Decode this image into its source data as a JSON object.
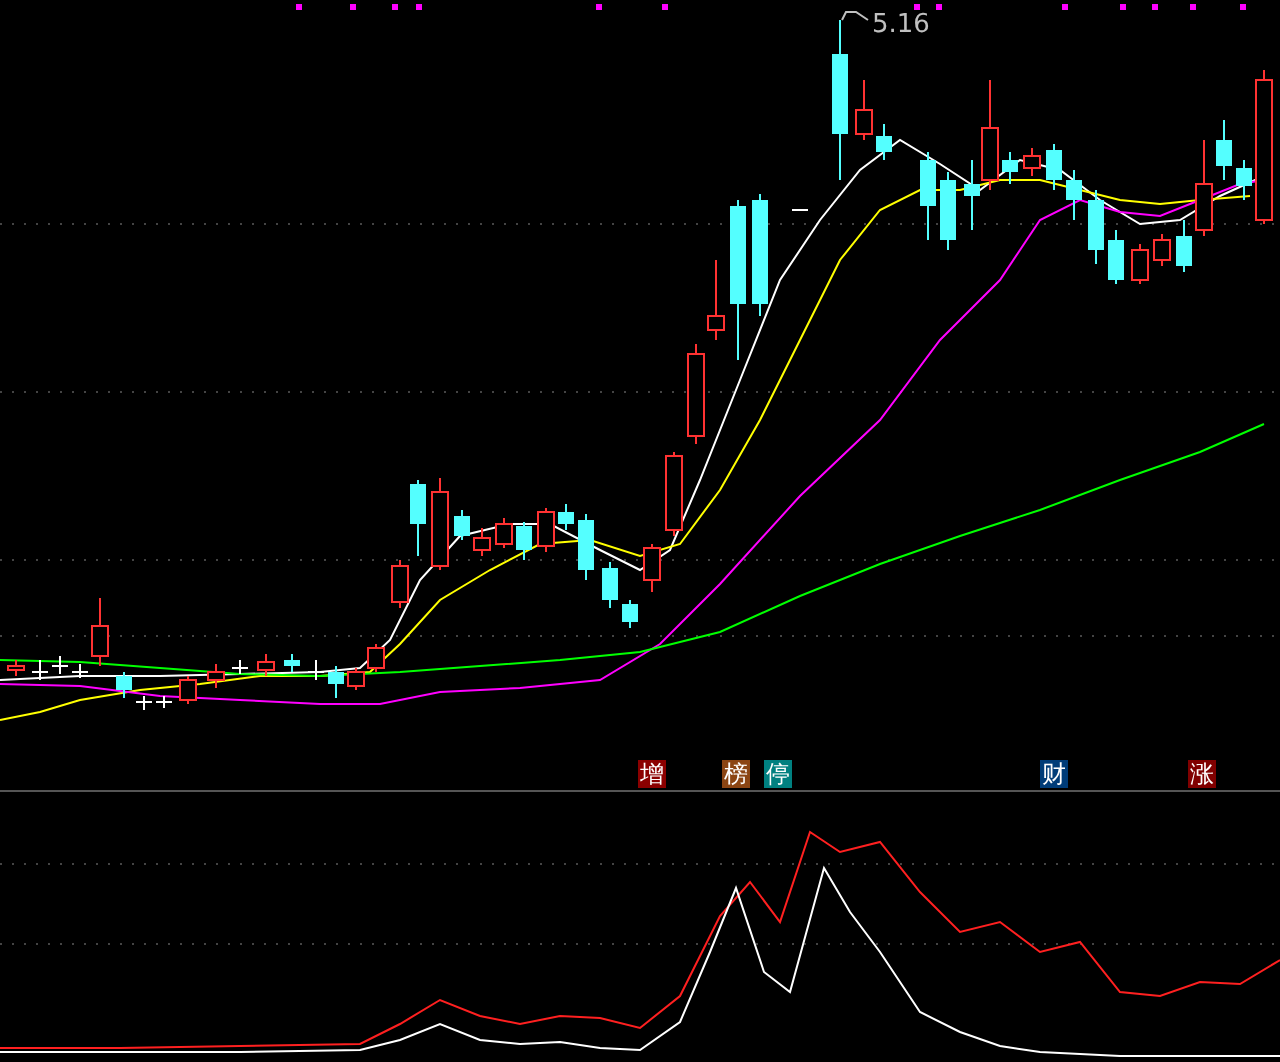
{
  "price_chart": {
    "high_label": "5.16"
  },
  "signals": [
    {
      "label": "增",
      "color": "#8b0000"
    },
    {
      "label": "榜",
      "color": "#8b4513"
    },
    {
      "label": "停",
      "color": "#008080"
    },
    {
      "label": "财",
      "color": "#003c78"
    },
    {
      "label": "涨",
      "color": "#800000"
    }
  ]
}
